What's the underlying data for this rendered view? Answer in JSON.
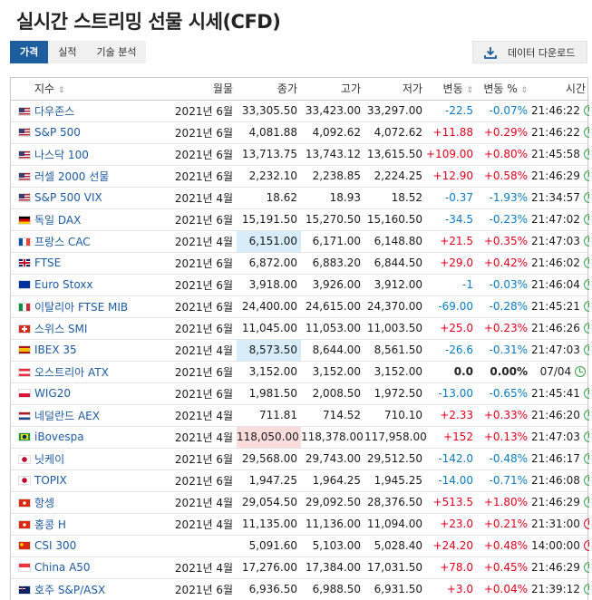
{
  "page_title": "실시간 스트리밍 선물 시세(CFD)",
  "tabs": [
    "가격",
    "실적",
    "기술 분석"
  ],
  "download_label": "데이터 다운로드",
  "columns": [
    "지수",
    "월물",
    "종가",
    "고가",
    "저가",
    "변동",
    "변동 %",
    "시간"
  ],
  "colors": {
    "positive": "#e0001b",
    "negative": "#0d7bc2",
    "accent": "#1f5e9e",
    "clock_open": "#3aa24a",
    "clock_closed": "#e0001b"
  },
  "rows": [
    {
      "flag": "us",
      "name": "다우존스",
      "month": "2021년 6월",
      "close": "33,305.50",
      "high": "33,423.00",
      "low": "33,297.00",
      "chg": "-22.5",
      "pct": "-0.07%",
      "time": "21:46:22",
      "dir": "neg",
      "clock": "open",
      "hl": ""
    },
    {
      "flag": "us",
      "name": "S&P 500",
      "month": "2021년 6월",
      "close": "4,081.88",
      "high": "4,092.62",
      "low": "4,072.62",
      "chg": "+11.88",
      "pct": "+0.29%",
      "time": "21:46:22",
      "dir": "pos",
      "clock": "open",
      "hl": ""
    },
    {
      "flag": "us",
      "name": "나스닥 100",
      "month": "2021년 6월",
      "close": "13,713.75",
      "high": "13,743.12",
      "low": "13,615.50",
      "chg": "+109.00",
      "pct": "+0.80%",
      "time": "21:45:58",
      "dir": "pos",
      "clock": "open",
      "hl": ""
    },
    {
      "flag": "us",
      "name": "러셀 2000 선물",
      "month": "2021년 6월",
      "close": "2,232.10",
      "high": "2,238.85",
      "low": "2,224.25",
      "chg": "+12.90",
      "pct": "+0.58%",
      "time": "21:46:29",
      "dir": "pos",
      "clock": "open",
      "hl": ""
    },
    {
      "flag": "us",
      "name": "S&P 500 VIX",
      "month": "2021년 4월",
      "close": "18.62",
      "high": "18.93",
      "low": "18.52",
      "chg": "-0.37",
      "pct": "-1.93%",
      "time": "21:34:57",
      "dir": "neg",
      "clock": "open",
      "hl": ""
    },
    {
      "flag": "de",
      "name": "독일 DAX",
      "month": "2021년 6월",
      "close": "15,191.50",
      "high": "15,270.50",
      "low": "15,160.50",
      "chg": "-34.5",
      "pct": "-0.23%",
      "time": "21:47:02",
      "dir": "neg",
      "clock": "open",
      "hl": ""
    },
    {
      "flag": "fr",
      "name": "프랑스 CAC",
      "month": "2021년 4월",
      "close": "6,151.00",
      "high": "6,171.00",
      "low": "6,148.80",
      "chg": "+21.5",
      "pct": "+0.35%",
      "time": "21:47:03",
      "dir": "pos",
      "clock": "open",
      "hl": "blue"
    },
    {
      "flag": "gb",
      "name": "FTSE",
      "month": "2021년 6월",
      "close": "6,872.00",
      "high": "6,883.20",
      "low": "6,844.50",
      "chg": "+29.0",
      "pct": "+0.42%",
      "time": "21:46:02",
      "dir": "pos",
      "clock": "open",
      "hl": ""
    },
    {
      "flag": "eu",
      "name": "Euro Stoxx",
      "month": "2021년 6월",
      "close": "3,918.00",
      "high": "3,926.00",
      "low": "3,912.00",
      "chg": "-1",
      "pct": "-0.03%",
      "time": "21:46:04",
      "dir": "neg",
      "clock": "open",
      "hl": ""
    },
    {
      "flag": "it",
      "name": "이탈리아 FTSE MIB",
      "month": "2021년 6월",
      "close": "24,400.00",
      "high": "24,615.00",
      "low": "24,370.00",
      "chg": "-69.00",
      "pct": "-0.28%",
      "time": "21:45:21",
      "dir": "neg",
      "clock": "open",
      "hl": ""
    },
    {
      "flag": "ch",
      "name": "스위스 SMI",
      "month": "2021년 6월",
      "close": "11,045.00",
      "high": "11,053.00",
      "low": "11,003.50",
      "chg": "+25.0",
      "pct": "+0.23%",
      "time": "21:46:26",
      "dir": "pos",
      "clock": "open",
      "hl": ""
    },
    {
      "flag": "es",
      "name": "IBEX 35",
      "month": "2021년 4월",
      "close": "8,573.50",
      "high": "8,644.00",
      "low": "8,561.50",
      "chg": "-26.6",
      "pct": "-0.31%",
      "time": "21:47:03",
      "dir": "neg",
      "clock": "open",
      "hl": "blue"
    },
    {
      "flag": "at",
      "name": "오스트리아 ATX",
      "month": "2021년 6월",
      "close": "3,152.00",
      "high": "3,152.00",
      "low": "3,152.00",
      "chg": "0.0",
      "pct": "0.00%",
      "time": "07/04",
      "dir": "neu",
      "clock": "open",
      "hl": ""
    },
    {
      "flag": "pl",
      "name": "WIG20",
      "month": "2021년 6월",
      "close": "1,981.50",
      "high": "2,008.50",
      "low": "1,972.50",
      "chg": "-13.00",
      "pct": "-0.65%",
      "time": "21:45:41",
      "dir": "neg",
      "clock": "open",
      "hl": ""
    },
    {
      "flag": "nl",
      "name": "네덜란드 AEX",
      "month": "2021년 4월",
      "close": "711.81",
      "high": "714.52",
      "low": "710.10",
      "chg": "+2.33",
      "pct": "+0.33%",
      "time": "21:46:20",
      "dir": "pos",
      "clock": "open",
      "hl": ""
    },
    {
      "flag": "br",
      "name": "iBovespa",
      "month": "2021년 4월",
      "close": "118,050.00",
      "high": "118,378.00",
      "low": "117,958.00",
      "chg": "+152",
      "pct": "+0.13%",
      "time": "21:47:03",
      "dir": "pos",
      "clock": "open",
      "hl": "red"
    },
    {
      "flag": "jp",
      "name": "닛케이",
      "month": "2021년 6월",
      "close": "29,568.00",
      "high": "29,743.00",
      "low": "29,512.50",
      "chg": "-142.0",
      "pct": "-0.48%",
      "time": "21:46:17",
      "dir": "neg",
      "clock": "open",
      "hl": ""
    },
    {
      "flag": "jp",
      "name": "TOPIX",
      "month": "2021년 6월",
      "close": "1,947.25",
      "high": "1,964.25",
      "low": "1,945.25",
      "chg": "-14.00",
      "pct": "-0.71%",
      "time": "21:46:08",
      "dir": "neg",
      "clock": "open",
      "hl": ""
    },
    {
      "flag": "hk",
      "name": "항셍",
      "month": "2021년 4월",
      "close": "29,054.50",
      "high": "29,092.50",
      "low": "28,376.50",
      "chg": "+513.5",
      "pct": "+1.80%",
      "time": "21:46:29",
      "dir": "pos",
      "clock": "open",
      "hl": ""
    },
    {
      "flag": "hk",
      "name": "홍콩 H",
      "month": "2021년 4월",
      "close": "11,135.00",
      "high": "11,136.00",
      "low": "11,094.00",
      "chg": "+23.0",
      "pct": "+0.21%",
      "time": "21:31:00",
      "dir": "pos",
      "clock": "closed",
      "hl": ""
    },
    {
      "flag": "cn",
      "name": "CSI 300",
      "month": "",
      "close": "5,091.60",
      "high": "5,103.00",
      "low": "5,028.40",
      "chg": "+24.20",
      "pct": "+0.48%",
      "time": "14:00:00",
      "dir": "pos",
      "clock": "closed",
      "hl": ""
    },
    {
      "flag": "sg",
      "name": "China A50",
      "month": "2021년 4월",
      "close": "17,276.00",
      "high": "17,384.00",
      "low": "17,031.50",
      "chg": "+78.0",
      "pct": "+0.45%",
      "time": "21:46:29",
      "dir": "pos",
      "clock": "open",
      "hl": ""
    },
    {
      "flag": "au",
      "name": "호주 S&P/ASX",
      "month": "2021년 6월",
      "close": "6,936.50",
      "high": "6,988.50",
      "low": "6,931.50",
      "chg": "+3.0",
      "pct": "+0.04%",
      "time": "21:39:12",
      "dir": "pos",
      "clock": "open",
      "hl": ""
    }
  ]
}
